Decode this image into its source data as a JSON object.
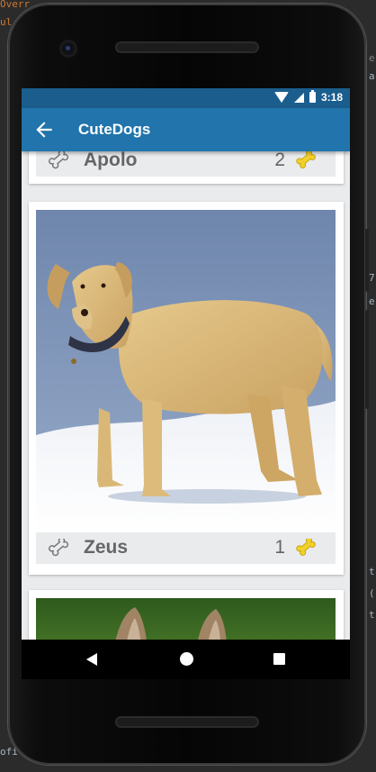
{
  "ide": {
    "frag_top_left": "Overr",
    "frag_left_2": "ul",
    "frag_right_1": "e",
    "frag_right_2": "a",
    "frag_right_3": "7",
    "frag_right_4": "e",
    "frag_right_5": "t",
    "frag_right_6": "(",
    "frag_right_7": "t",
    "frag_bottom_left": "ofi"
  },
  "status_bar": {
    "time": "3:18"
  },
  "app_bar": {
    "title": "CuteDogs"
  },
  "dogs": [
    {
      "name": "Apolo",
      "likes": "2"
    },
    {
      "name": "Zeus",
      "likes": "1"
    }
  ],
  "colors": {
    "status_bar": "#1b5e8e",
    "app_bar": "#2174ac",
    "bone_fill": "#f2d02b",
    "text": "#666666",
    "background": "#e9ebed"
  },
  "icons": {
    "back": "arrow-left-icon",
    "unliked": "bone-outline-icon",
    "liked": "bone-filled-icon",
    "nav_back": "triangle-back-icon",
    "nav_home": "circle-home-icon",
    "nav_recent": "square-recents-icon"
  }
}
